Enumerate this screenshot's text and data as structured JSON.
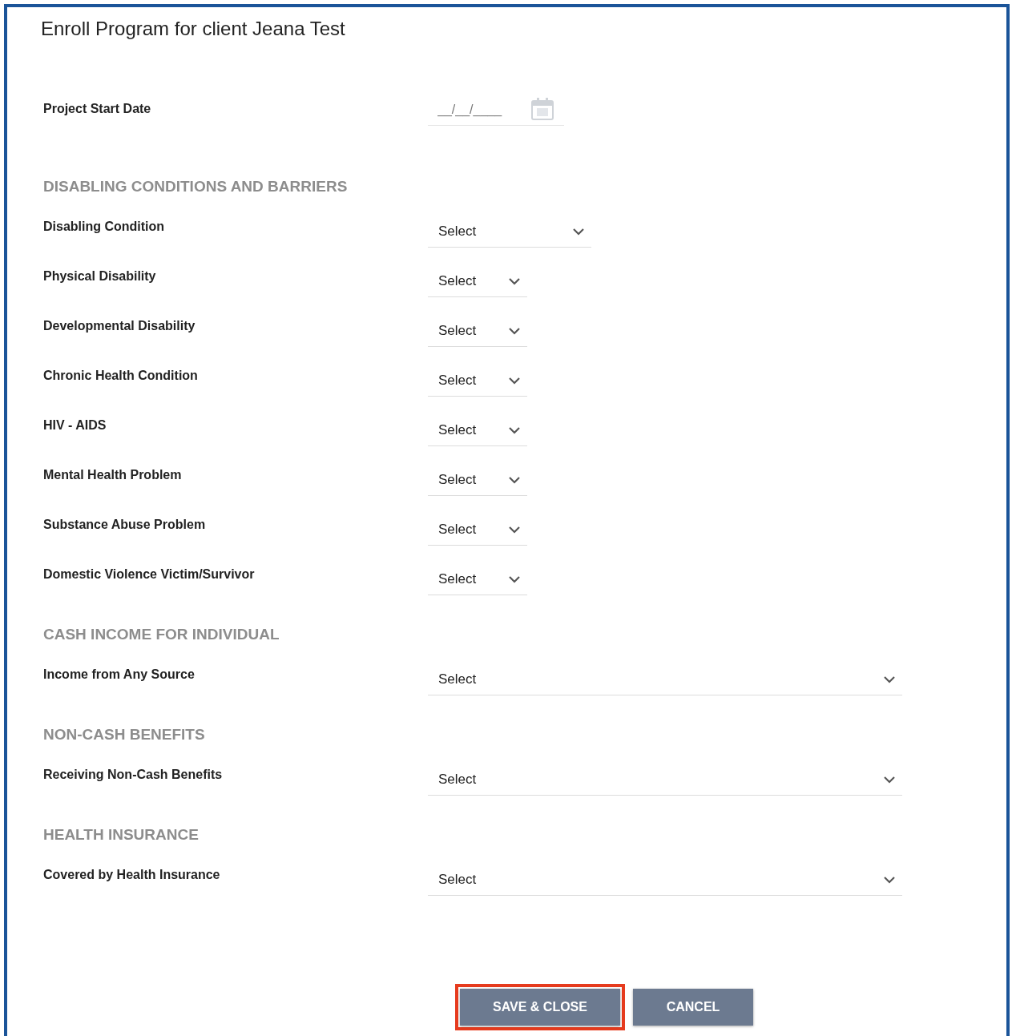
{
  "title": "Enroll Program for client Jeana Test",
  "sections": [
    {
      "fields": [
        {
          "label": "Project Start Date",
          "kind": "date",
          "placeholder": "__/__/____"
        }
      ]
    },
    {
      "heading": "DISABLING CONDITIONS AND BARRIERS",
      "fields": [
        {
          "label": "Disabling Condition",
          "kind": "medium",
          "value": "Select"
        },
        {
          "label": "Physical Disability",
          "kind": "narrow",
          "value": "Select"
        },
        {
          "label": "Developmental Disability",
          "kind": "narrow",
          "value": "Select"
        },
        {
          "label": "Chronic Health Condition",
          "kind": "narrow",
          "value": "Select"
        },
        {
          "label": "HIV - AIDS",
          "kind": "narrow",
          "value": "Select"
        },
        {
          "label": "Mental Health Problem",
          "kind": "narrow",
          "value": "Select"
        },
        {
          "label": "Substance Abuse Problem",
          "kind": "narrow",
          "value": "Select"
        },
        {
          "label": "Domestic Violence Victim/Survivor",
          "kind": "narrow",
          "value": "Select"
        }
      ]
    },
    {
      "heading": "CASH INCOME FOR INDIVIDUAL",
      "fields": [
        {
          "label": "Income from Any Source",
          "kind": "wide",
          "value": "Select"
        }
      ]
    },
    {
      "heading": "NON-CASH BENEFITS",
      "fields": [
        {
          "label": "Receiving Non-Cash Benefits",
          "kind": "wide",
          "value": "Select"
        }
      ]
    },
    {
      "heading": "HEALTH INSURANCE",
      "fields": [
        {
          "label": "Covered by Health Insurance",
          "kind": "wide",
          "value": "Select"
        }
      ]
    }
  ],
  "buttons": [
    {
      "label": "SAVE & CLOSE",
      "highlighted": true
    },
    {
      "label": "CANCEL",
      "highlighted": false
    }
  ]
}
